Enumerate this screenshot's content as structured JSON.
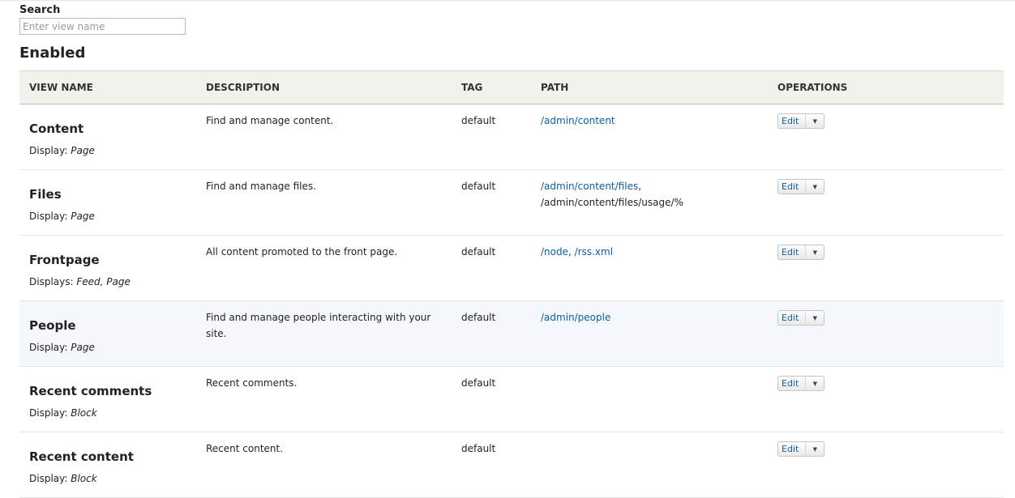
{
  "search": {
    "label": "Search",
    "placeholder": "Enter view name"
  },
  "section_title": "Enabled",
  "columns": [
    "VIEW NAME",
    "DESCRIPTION",
    "TAG",
    "PATH",
    "OPERATIONS"
  ],
  "rows": [
    {
      "name": "Content",
      "display_label": "Display:",
      "displays": "Page",
      "description": "Find and manage content.",
      "tag": "default",
      "paths": [
        {
          "text": "/admin/content",
          "link": true
        }
      ],
      "operation": "Edit"
    },
    {
      "name": "Files",
      "display_label": "Display:",
      "displays": "Page",
      "description": "Find and manage files.",
      "tag": "default",
      "paths": [
        {
          "text": "/admin/content/files",
          "link": true
        },
        {
          "text": "/admin/content/files/usage/%",
          "link": false
        }
      ],
      "operation": "Edit"
    },
    {
      "name": "Frontpage",
      "display_label": "Displays:",
      "displays": "Feed, Page",
      "description": "All content promoted to the front page.",
      "tag": "default",
      "paths": [
        {
          "text": "/node",
          "link": true
        },
        {
          "text": "/rss.xml",
          "link": true
        }
      ],
      "operation": "Edit"
    },
    {
      "name": "People",
      "display_label": "Display:",
      "displays": "Page",
      "description": "Find and manage people interacting with your site.",
      "tag": "default",
      "paths": [
        {
          "text": "/admin/people",
          "link": true
        }
      ],
      "operation": "Edit",
      "highlighted": true
    },
    {
      "name": "Recent comments",
      "display_label": "Display:",
      "displays": "Block",
      "description": "Recent comments.",
      "tag": "default",
      "paths": [],
      "operation": "Edit"
    },
    {
      "name": "Recent content",
      "display_label": "Display:",
      "displays": "Block",
      "description": "Recent content.",
      "tag": "default",
      "paths": [],
      "operation": "Edit"
    }
  ],
  "colors": {
    "link": "#0b5ea8",
    "header_bg": "#f2f1eb",
    "highlight_row": "#f4f8fc"
  },
  "icons": {
    "dropdown": "chevron-down-icon"
  }
}
